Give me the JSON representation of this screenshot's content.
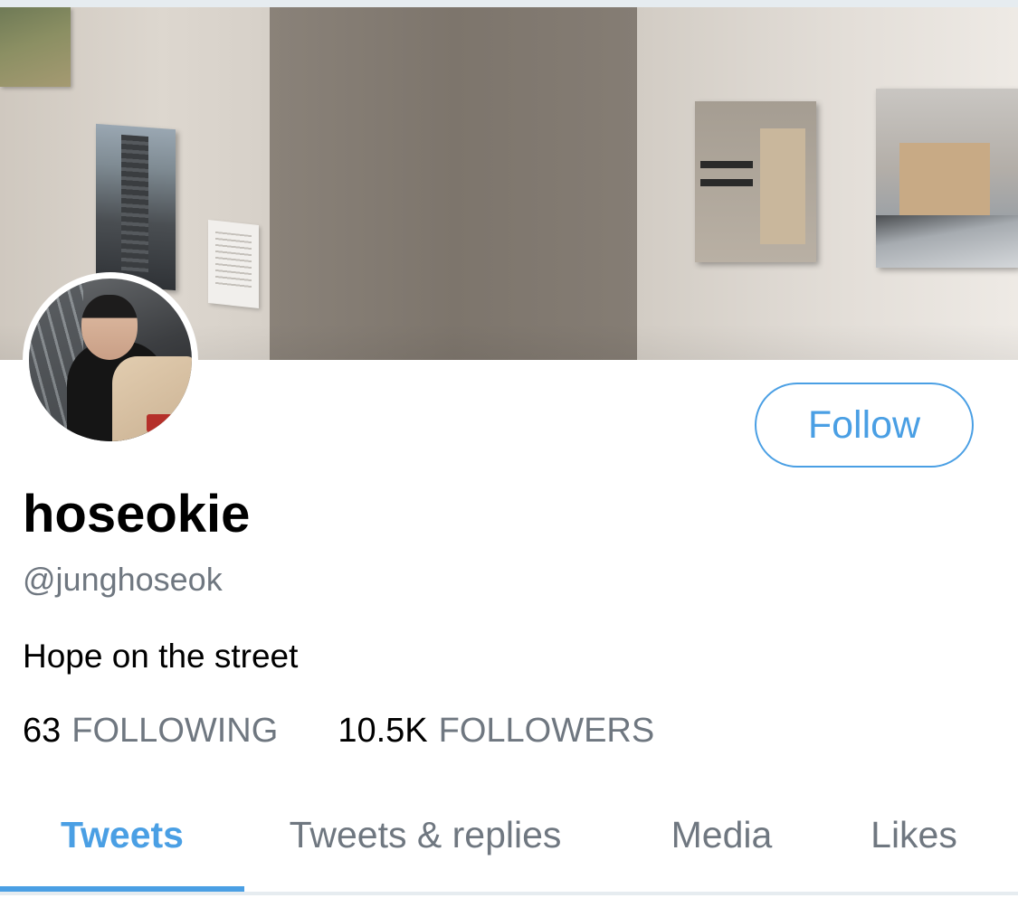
{
  "profile": {
    "display_name": "hoseokie",
    "handle": "@junghoseok",
    "bio": "Hope on the street"
  },
  "follow_button": {
    "label": "Follow"
  },
  "stats": {
    "following_count": "63",
    "following_label": "FOLLOWING",
    "followers_count": "10.5K",
    "followers_label": "FOLLOWERS"
  },
  "tabs": [
    {
      "label": "Tweets",
      "active": true
    },
    {
      "label": "Tweets & replies",
      "active": false
    },
    {
      "label": "Media",
      "active": false
    },
    {
      "label": "Likes",
      "active": false
    }
  ],
  "colors": {
    "accent": "#4a9fe4",
    "secondary_text": "#6f7780",
    "primary_text": "#000000",
    "divider": "#e6ecf0"
  }
}
